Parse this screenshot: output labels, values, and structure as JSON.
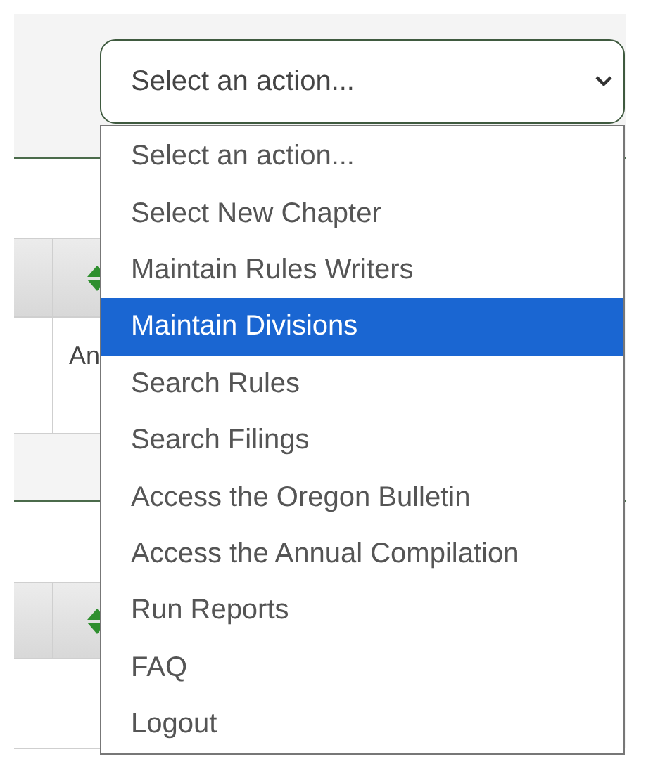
{
  "action_select": {
    "value": "Select an action...",
    "expanded": true
  },
  "options": [
    {
      "label": "Select an action...",
      "selected": false
    },
    {
      "label": "Select New Chapter",
      "selected": false
    },
    {
      "label": "Maintain Rules Writers",
      "selected": false
    },
    {
      "label": "Maintain Divisions",
      "selected": true
    },
    {
      "label": "Search Rules",
      "selected": false
    },
    {
      "label": "Search Filings",
      "selected": false
    },
    {
      "label": "Access the Oregon Bulletin",
      "selected": false
    },
    {
      "label": "Access the Annual Compilation",
      "selected": false
    },
    {
      "label": "Run Reports",
      "selected": false
    },
    {
      "label": "FAQ",
      "selected": false
    },
    {
      "label": "Logout",
      "selected": false
    }
  ],
  "table": {
    "cell_text": "An"
  }
}
